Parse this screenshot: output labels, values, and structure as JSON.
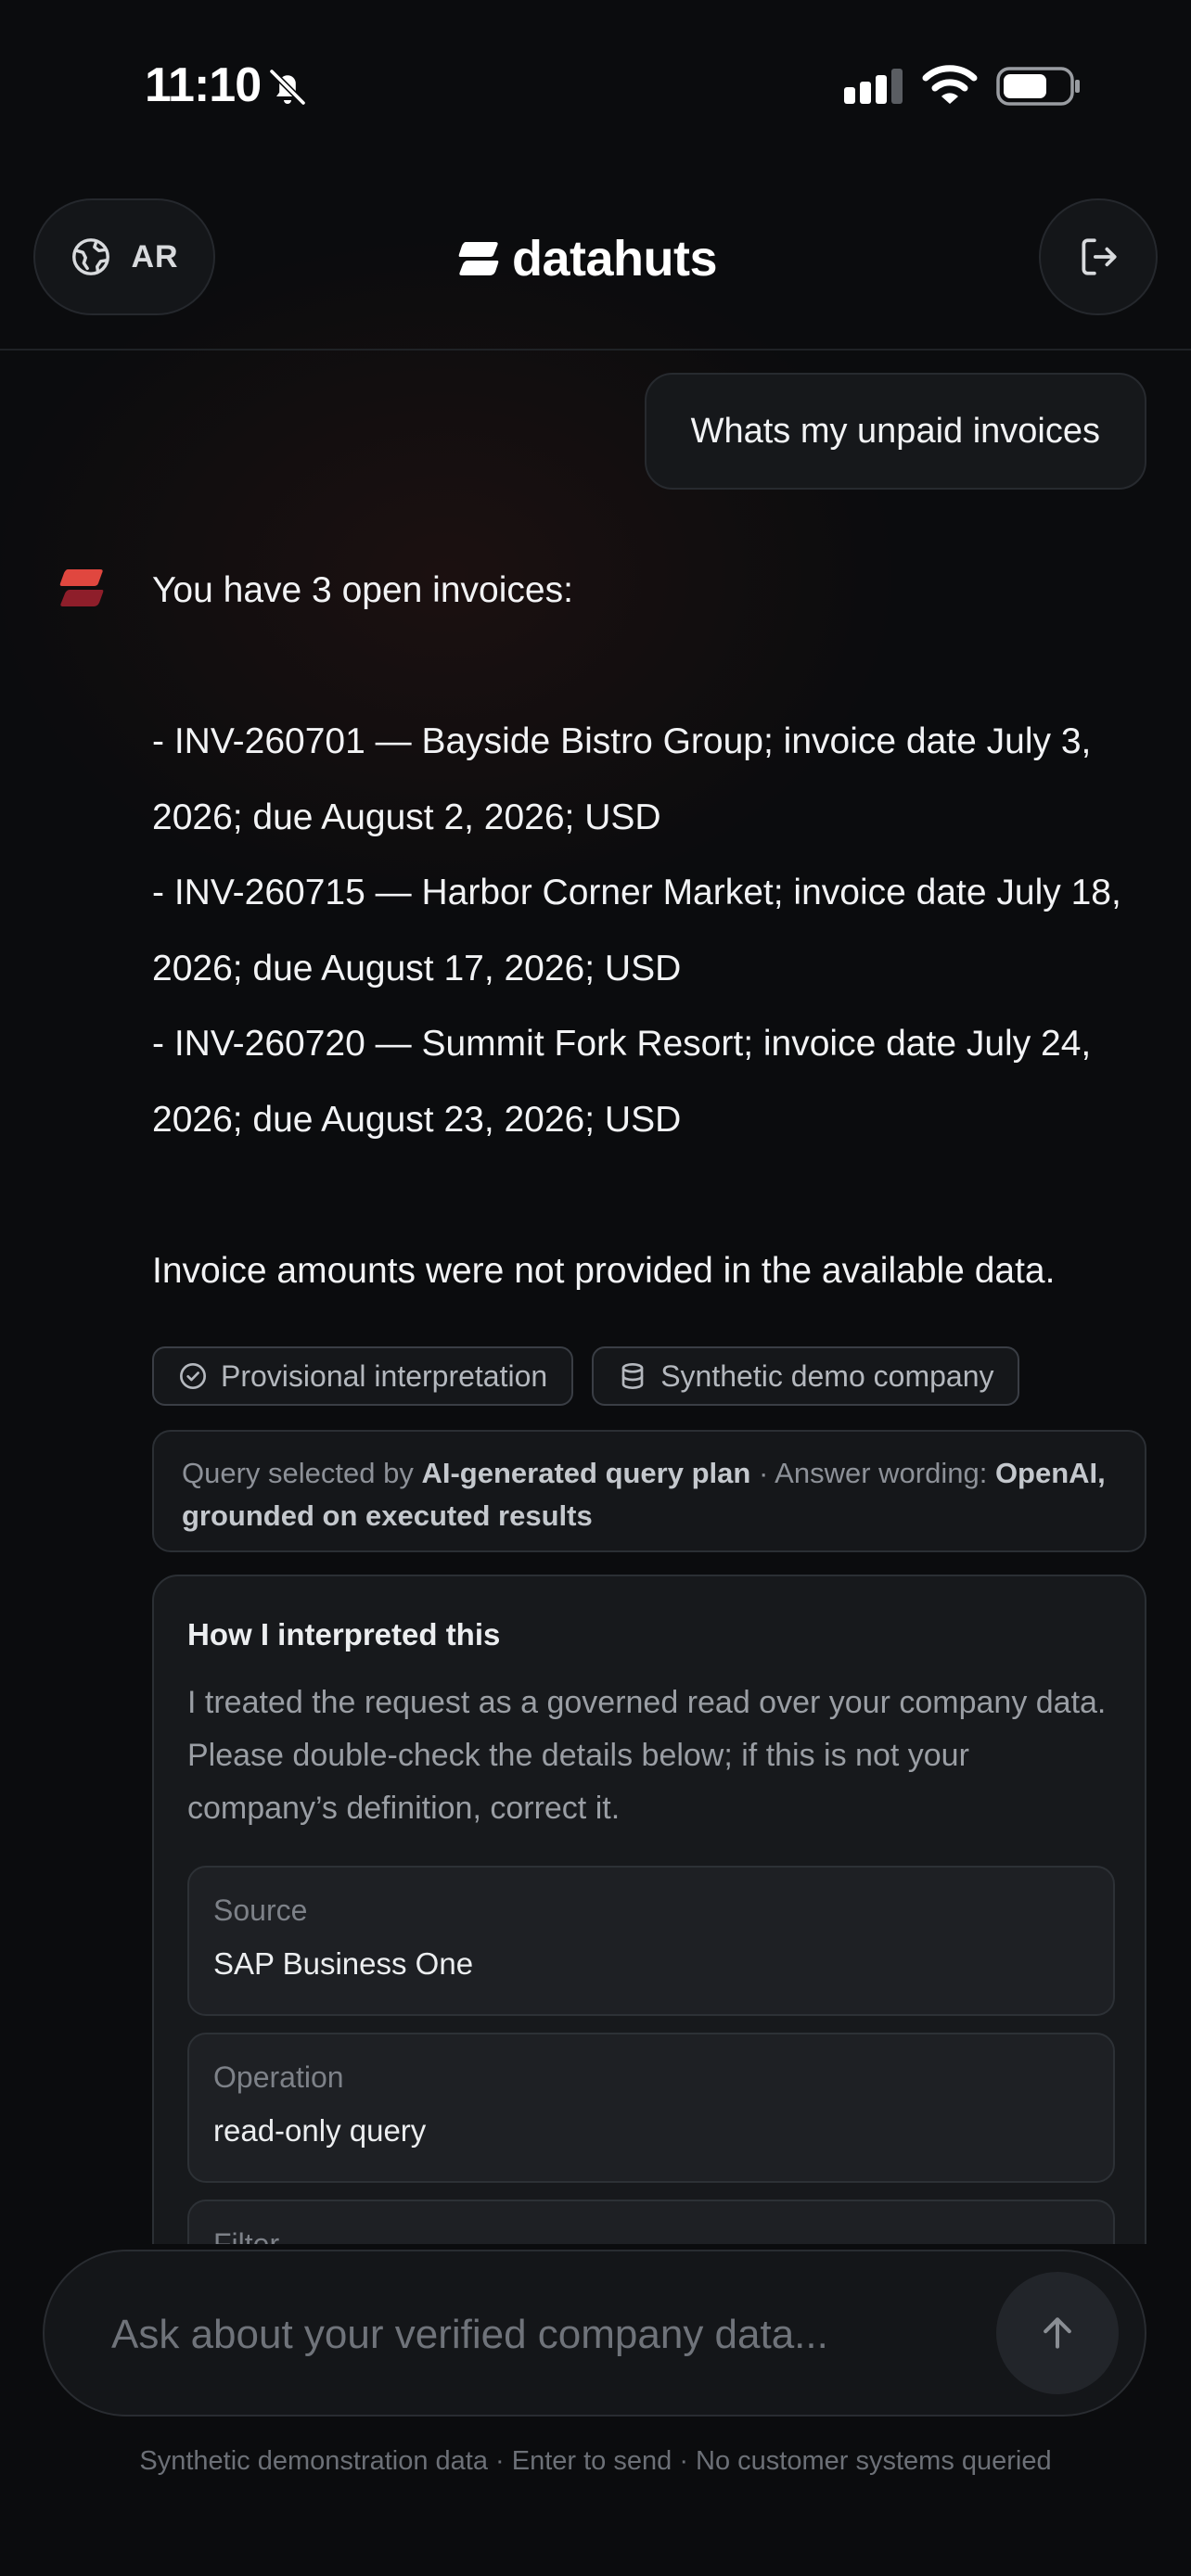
{
  "status_bar": {
    "time": "11:10",
    "icons": [
      "bell-slash-icon",
      "cellular-signal-icon",
      "wifi-icon",
      "battery-icon"
    ]
  },
  "header": {
    "language_label": "AR",
    "brand_name": "datahuts",
    "icons": [
      "globe-icon",
      "brand-logo-icon",
      "logout-icon"
    ]
  },
  "conversation": {
    "user_message": "Whats my unpaid invoices",
    "assistant": {
      "intro": "You have 3 open invoices:",
      "invoice_lines": [
        "- INV-260701 — Bayside Bistro Group; invoice date July 3, 2026; due August 2, 2026; USD",
        "- INV-260715 — Harbor Corner Market; invoice date July 18, 2026; due August 17, 2026; USD",
        "- INV-260720 — Summit Fork Resort; invoice date July 24, 2026; due August 23, 2026; USD"
      ],
      "note": "Invoice amounts were not provided in the available data.",
      "chips": {
        "provisional": "Provisional interpretation",
        "synthetic": "Synthetic demo company"
      },
      "provenance": {
        "prefix": "Query selected by ",
        "selector": "AI-generated query plan",
        "middle": " · Answer wording: ",
        "wording": "OpenAI, grounded on executed results"
      },
      "interpretation": {
        "title": "How I interpreted this",
        "description": "I treated the request as a governed read over your company data. Please double-check the details below; if this is not your company’s definition, correct it.",
        "fields": [
          {
            "label": "Source",
            "value": "SAP Business One"
          },
          {
            "label": "Operation",
            "value": "read-only query"
          },
          {
            "label": "Filter",
            "value": ""
          }
        ]
      }
    }
  },
  "composer": {
    "placeholder": "Ask about your verified company data...",
    "footer": "Synthetic demonstration data · Enter to send · No customer systems queried"
  },
  "colors": {
    "background": "#0b0c0e",
    "surface": "#17191c",
    "brand_red": "#e0473f",
    "brand_dark_red": "#8e1e2a"
  }
}
